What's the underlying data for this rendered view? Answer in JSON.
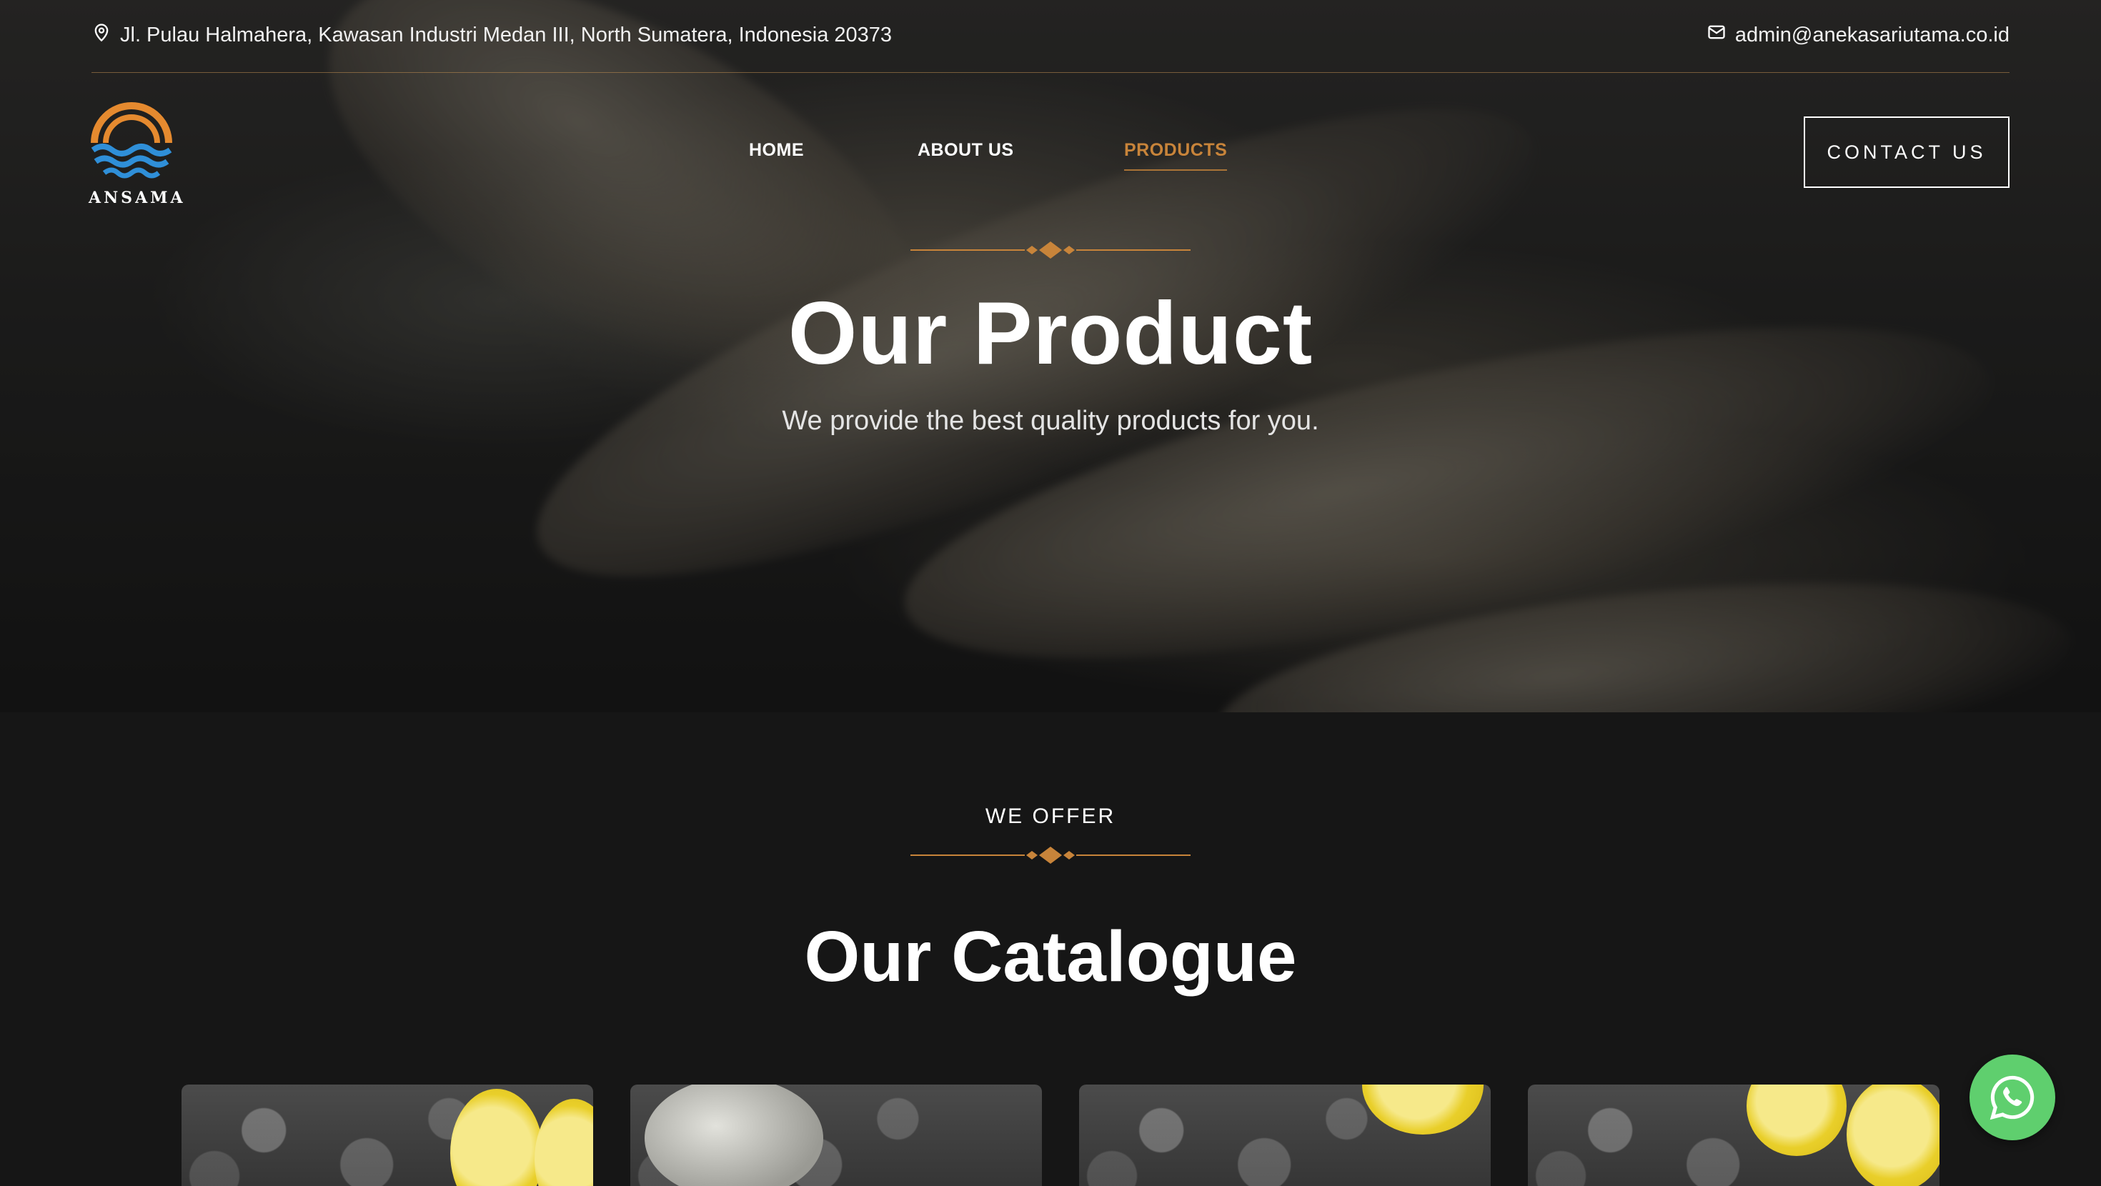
{
  "topbar": {
    "address": "Jl. Pulau Halmahera, Kawasan Industri Medan III, North Sumatera, Indonesia 20373",
    "email": "admin@anekasariutama.co.id"
  },
  "brand": {
    "name": "ANSAMA"
  },
  "nav": {
    "items": [
      {
        "label": "HOME",
        "active": false
      },
      {
        "label": "ABOUT US",
        "active": false
      },
      {
        "label": "PRODUCTS",
        "active": true
      }
    ],
    "contact_label": "CONTACT US"
  },
  "hero": {
    "title": "Our Product",
    "subtitle": "We provide the best quality products for you."
  },
  "catalogue": {
    "eyebrow": "WE OFFER",
    "title": "Our Catalogue"
  },
  "colors": {
    "accent": "#c8843a",
    "background": "#161616",
    "whatsapp": "#5fcf6e"
  },
  "icons": {
    "address": "map-pin-icon",
    "email": "envelope-icon",
    "chat": "whatsapp-icon"
  }
}
